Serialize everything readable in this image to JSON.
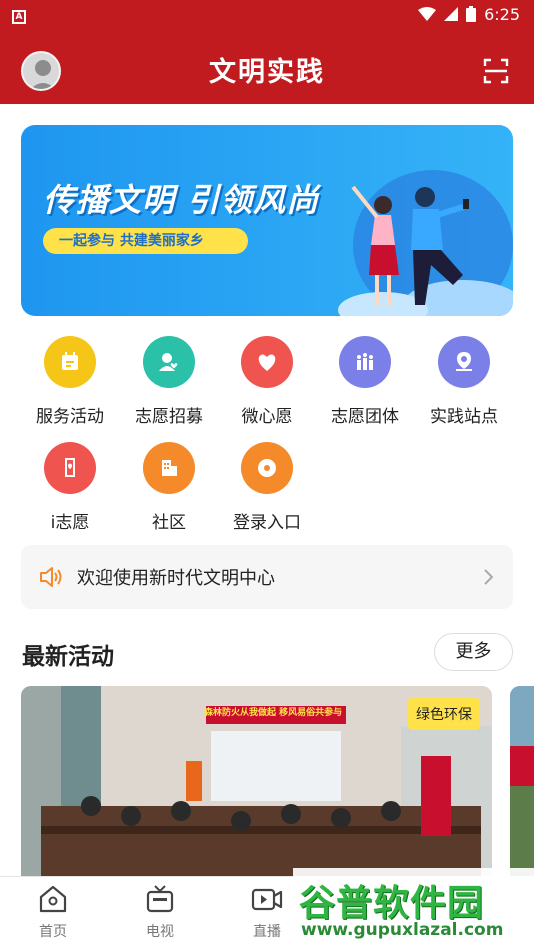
{
  "status": {
    "time": "6:25"
  },
  "header": {
    "title": "文明实践"
  },
  "banner": {
    "headline": "传播文明 引领风尚",
    "tagline": "一起参与 共建美丽家乡"
  },
  "services": [
    {
      "label": "服务活动",
      "icon": "calendar-icon",
      "color": "#f5c518"
    },
    {
      "label": "志愿招募",
      "icon": "person-heart-icon",
      "color": "#2bc0a8"
    },
    {
      "label": "微心愿",
      "icon": "heart-icon",
      "color": "#f0544f"
    },
    {
      "label": "志愿团体",
      "icon": "group-icon",
      "color": "#7b7fe8"
    },
    {
      "label": "实践站点",
      "icon": "map-pin-icon",
      "color": "#7b7fe8"
    },
    {
      "label": "i志愿",
      "icon": "volunteer-icon",
      "color": "#f0544f"
    },
    {
      "label": "社区",
      "icon": "building-icon",
      "color": "#f58a2a"
    },
    {
      "label": "登录入口",
      "icon": "login-icon",
      "color": "#f58a2a"
    }
  ],
  "notice": {
    "text": "欢迎使用新时代文明中心"
  },
  "section": {
    "title": "最新活动",
    "more": "更多"
  },
  "activity": {
    "tag": "绿色环保",
    "banner_text": "森林防火从我做起 移风易俗共参与"
  },
  "tabs": [
    {
      "label": "首页",
      "icon": "home-icon"
    },
    {
      "label": "电视",
      "icon": "tv-icon"
    },
    {
      "label": "直播",
      "icon": "video-icon"
    }
  ],
  "watermark": {
    "main": "谷普软件园",
    "url": "www.gupuxlazal.com"
  }
}
